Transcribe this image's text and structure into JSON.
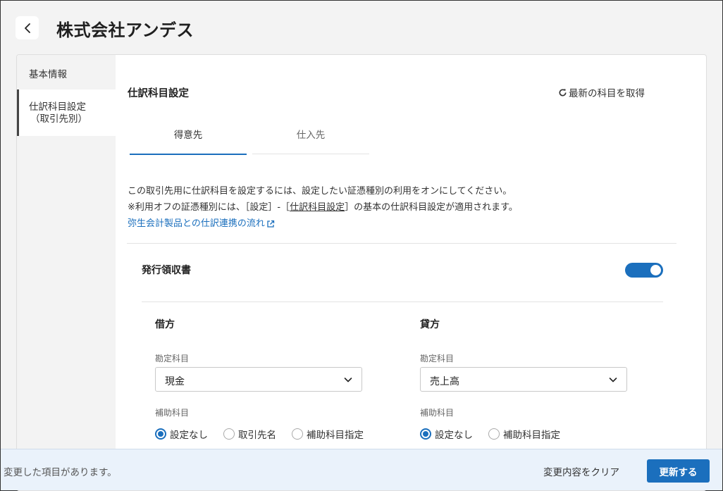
{
  "header": {
    "title": "株式会社アンデス"
  },
  "sidebar": {
    "items": [
      {
        "label": "基本情報"
      },
      {
        "label_line1": "仕訳科目設定",
        "label_line2": "（取引先別）"
      }
    ]
  },
  "main": {
    "section_title": "仕訳科目設定",
    "refresh_label": "最新の科目を取得",
    "tabs": [
      {
        "label": "得意先",
        "active": true
      },
      {
        "label": "仕入先",
        "active": false
      }
    ],
    "description": {
      "line1": "この取引先用に仕訳科目を設定するには、設定したい証憑種別の利用をオンにしてください。",
      "line2_prefix": "※利用オフの証憑種別には、［設定］-［",
      "line2_link": "仕訳科目設定",
      "line2_suffix": "］の基本の仕訳科目設定が適用されます。",
      "flow_link": "弥生会計製品との仕訳連携の流れ"
    },
    "receipt": {
      "title": "発行領収書",
      "enabled": true,
      "debit": {
        "title": "借方",
        "account_label": "勘定科目",
        "account_value": "現金",
        "sub_label": "補助科目",
        "options": [
          "設定なし",
          "取引先名",
          "補助科目指定"
        ],
        "selected": 0
      },
      "credit": {
        "title": "貸方",
        "account_label": "勘定科目",
        "account_value": "売上高",
        "sub_label": "補助科目",
        "options": [
          "設定なし",
          "補助科目指定"
        ],
        "selected": 0
      }
    }
  },
  "footer": {
    "message": "変更した項目があります。",
    "clear_label": "変更内容をクリア",
    "update_label": "更新する"
  },
  "colors": {
    "accent": "#1b6fbd",
    "footer_bg": "#eaf2fb"
  }
}
